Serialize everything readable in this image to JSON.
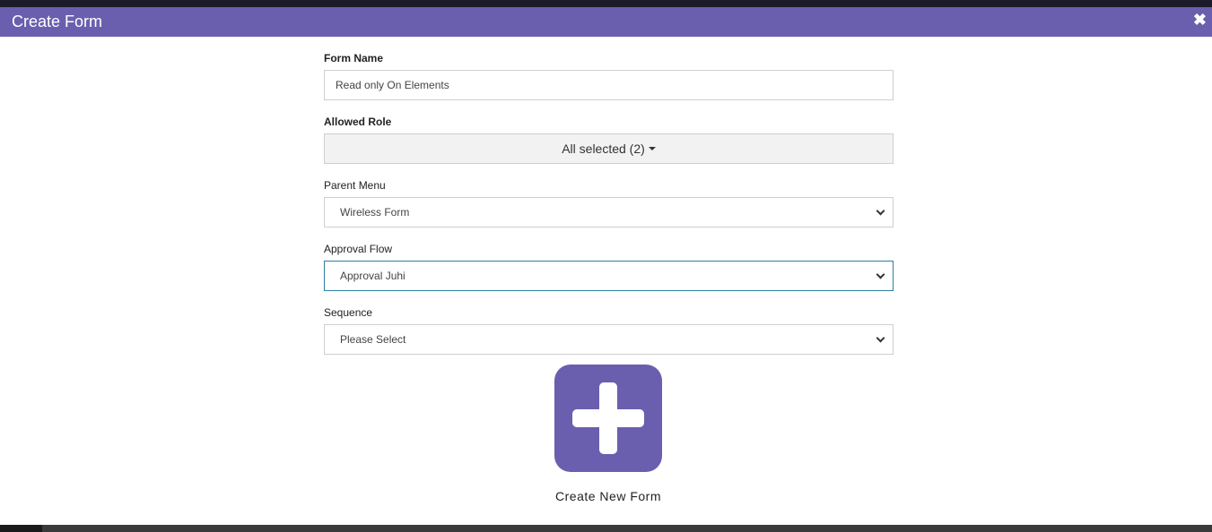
{
  "modal": {
    "title": "Create Form",
    "close_glyph": "✖"
  },
  "form": {
    "form_name": {
      "label": "Form Name",
      "value": "Read only On Elements"
    },
    "allowed_role": {
      "label": "Allowed Role",
      "value": "All selected (2)"
    },
    "parent_menu": {
      "label": "Parent Menu",
      "value": "Wireless Form"
    },
    "approval_flow": {
      "label": "Approval Flow",
      "value": "Approval Juhi"
    },
    "sequence": {
      "label": "Sequence",
      "value": "Please Select"
    }
  },
  "create": {
    "label": "Create New Form",
    "icon": "plus-icon"
  },
  "colors": {
    "accent": "#6a5fae",
    "focus_border": "#2e7fa3"
  }
}
